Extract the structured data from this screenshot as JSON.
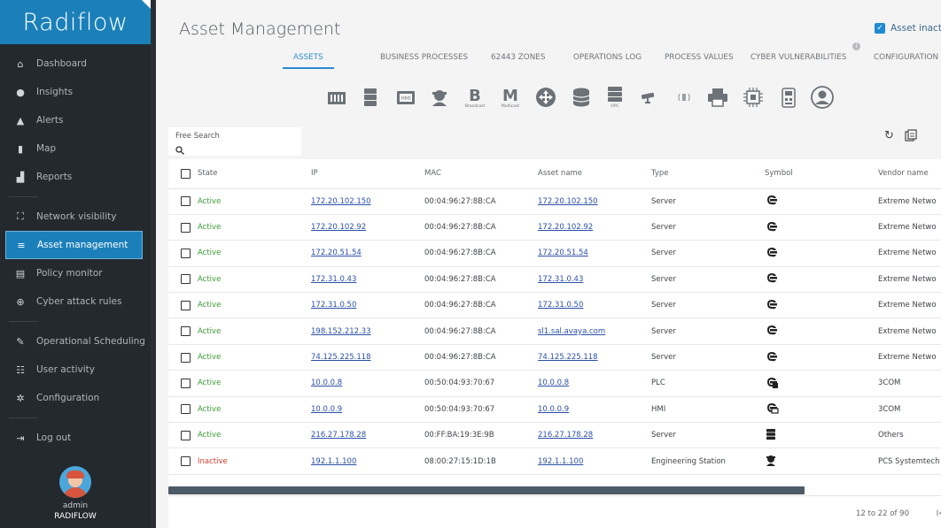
{
  "sidebar": {
    "logo": "Radiflow",
    "items": [
      {
        "label": "Dashboard",
        "icon": "home-icon",
        "glyph": "⌂"
      },
      {
        "label": "Insights",
        "icon": "lightbulb-icon",
        "glyph": "●"
      },
      {
        "label": "Alerts",
        "icon": "warning-icon",
        "glyph": "▲"
      },
      {
        "label": "Map",
        "icon": "map-icon",
        "glyph": "▮"
      },
      {
        "label": "Reports",
        "icon": "chart-icon",
        "glyph": "▟"
      },
      {
        "label": "Network visibility",
        "icon": "network-icon",
        "glyph": "⛶"
      },
      {
        "label": "Asset management",
        "icon": "database-icon",
        "glyph": "≡"
      },
      {
        "label": "Policy monitor",
        "icon": "document-icon",
        "glyph": "▤"
      },
      {
        "label": "Cyber attack rules",
        "icon": "target-icon",
        "glyph": "⊕"
      },
      {
        "label": "Operational Scheduling",
        "icon": "wrench-icon",
        "glyph": "✎"
      },
      {
        "label": "User activity",
        "icon": "users-icon",
        "glyph": "☷"
      },
      {
        "label": "Configuration",
        "icon": "gear-icon",
        "glyph": "✲"
      },
      {
        "label": "Log out",
        "icon": "logout-icon",
        "glyph": "⇥"
      }
    ],
    "user": {
      "name": "admin",
      "org": "RADIFLOW"
    }
  },
  "header": {
    "title": "Asset Management",
    "toggle_label": "Asset inacti"
  },
  "tabs": [
    "ASSETS",
    "BUSINESS PROCESSES",
    "62443 ZONES",
    "OPERATIONS LOG",
    "PROCESS VALUES",
    "CYBER VULNERABILITIES",
    "CONFIGURATION"
  ],
  "toolbar_icons": [
    "rack-icon",
    "server-icon",
    "hmi-icon",
    "engineer-icon",
    "broadcast-icon",
    "multicast-icon",
    "switch-icon",
    "database-icon",
    "opc-icon",
    "camera-icon",
    "wireless-icon",
    "printer-icon",
    "cpu-icon",
    "ied-icon",
    "user-icon"
  ],
  "toolbar_labels": {
    "hmi": "HMI",
    "broadcast_letter": "B",
    "broadcast_label": "Broadcast",
    "multicast_letter": "M",
    "multicast_label": "Multicast",
    "opc_label": "OPC"
  },
  "search": {
    "label": "Free Search",
    "placeholder": ""
  },
  "table": {
    "columns": [
      "State",
      "IP",
      "MAC",
      "Asset name",
      "Type",
      "Symbol",
      "Vendor name"
    ],
    "rows": [
      {
        "state": "Active",
        "ip": "172.20.102.150",
        "mac": "00:04:96:27:8B:CA",
        "name": "172.20.102.150",
        "type": "Server",
        "symbol": "server-cloud-icon",
        "vendor": "Extreme Netwo"
      },
      {
        "state": "Active",
        "ip": "172.20.102.92",
        "mac": "00:04:96:27:8B:CA",
        "name": "172.20.102.92",
        "type": "Server",
        "symbol": "server-cloud-icon",
        "vendor": "Extreme Netwo"
      },
      {
        "state": "Active",
        "ip": "172.20.51.54",
        "mac": "00:04:96:27:8B:CA",
        "name": "172.20.51.54",
        "type": "Server",
        "symbol": "server-cloud-icon",
        "vendor": "Extreme Netwo"
      },
      {
        "state": "Active",
        "ip": "172.31.0.43",
        "mac": "00:04:96:27:8B:CA",
        "name": "172.31.0.43",
        "type": "Server",
        "symbol": "server-cloud-icon",
        "vendor": "Extreme Netwo"
      },
      {
        "state": "Active",
        "ip": "172.31.0.50",
        "mac": "00:04:96:27:8B:CA",
        "name": "172.31.0.50",
        "type": "Server",
        "symbol": "server-cloud-icon",
        "vendor": "Extreme Netwo"
      },
      {
        "state": "Active",
        "ip": "198.152.212.33",
        "mac": "00:04:96:27:8B:CA",
        "name": "sl1.sal.avaya.com",
        "type": "Server",
        "symbol": "server-cloud-icon",
        "vendor": "Extreme Netwo"
      },
      {
        "state": "Active",
        "ip": "74.125.225.118",
        "mac": "00:04:96:27:8B:CA",
        "name": "74.125.225.118",
        "type": "Server",
        "symbol": "server-cloud-icon",
        "vendor": "Extreme Netwo"
      },
      {
        "state": "Active",
        "ip": "10.0.0.8",
        "mac": "00:50:04:93:70:67",
        "name": "10.0.0.8",
        "type": "PLC",
        "symbol": "plc-cloud-icon",
        "vendor": "3COM"
      },
      {
        "state": "Active",
        "ip": "10.0.0.9",
        "mac": "00:50:04:93:70:67",
        "name": "10.0.0.9",
        "type": "HMI",
        "symbol": "hmi-cloud-icon",
        "vendor": "3COM"
      },
      {
        "state": "Active",
        "ip": "216.27.178.28",
        "mac": "00:FF:BA:19:3E:9B",
        "name": "216.27.178.28",
        "type": "Server",
        "symbol": "server-icon",
        "vendor": "Others"
      },
      {
        "state": "Inactive",
        "ip": "192.1.1.100",
        "mac": "08:00:27:15:1D:1B",
        "name": "192.1.1.100",
        "type": "Engineering Station",
        "symbol": "engineer-icon",
        "vendor": "PCS Systemtech"
      }
    ]
  },
  "pagination": {
    "text": "12 to 22 of 90",
    "nav": "I<"
  },
  "colors": {
    "sidebar_bg": "#24292e",
    "accent": "#1b80b9",
    "active_text": "#3c9a37",
    "inactive_text": "#d83a2c",
    "link": "#2b4fa8"
  }
}
